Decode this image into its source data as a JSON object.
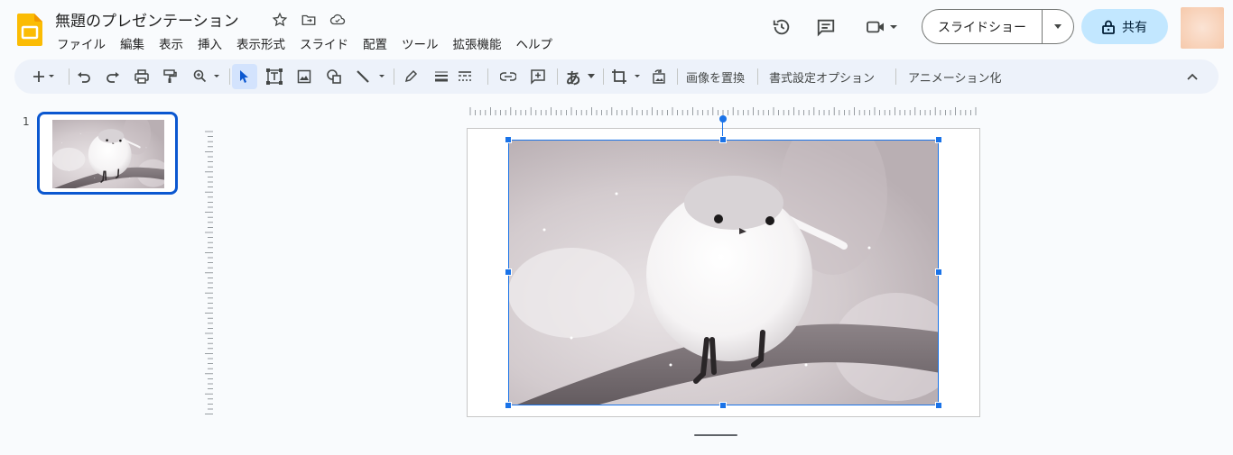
{
  "app": {
    "title": "無題のプレゼンテーション",
    "logo_icon": "slides-logo-icon",
    "brand_color": "#fbbc04"
  },
  "menu": [
    "ファイル",
    "編集",
    "表示",
    "挿入",
    "表示形式",
    "スライド",
    "配置",
    "ツール",
    "拡張機能",
    "ヘルプ"
  ],
  "header": {
    "slideshow_label": "スライドショー",
    "share_label": "共有",
    "accent": "#c2e7ff"
  },
  "toolbar": {
    "replace_image": "画像を置換",
    "format_options": "書式設定オプション",
    "animation": "アニメーション化",
    "input_mode": "あ"
  },
  "filmstrip": {
    "slides": [
      {
        "number": "1"
      }
    ]
  },
  "selection_color": "#1a73e8"
}
